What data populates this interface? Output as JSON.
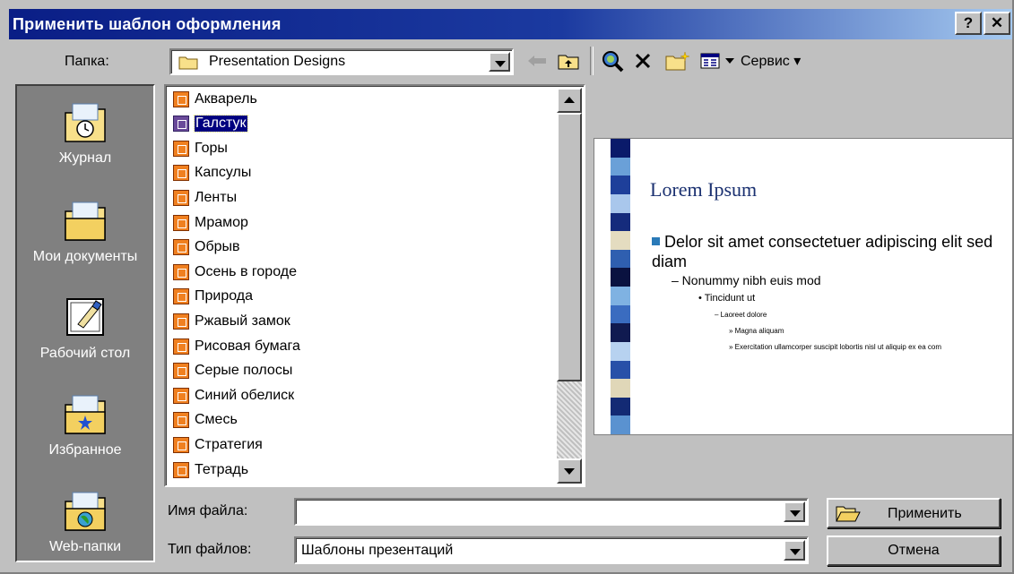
{
  "window": {
    "title": "Применить шаблон оформления",
    "help_label": "?",
    "close_label": "✕"
  },
  "toolbar": {
    "folder_label": "Папка:",
    "folder_value": "Presentation Designs",
    "tools_label": "Сервис ▾",
    "icons": [
      "back-icon",
      "up-folder-icon",
      "search-web-icon",
      "delete-icon",
      "new-folder-icon",
      "views-icon"
    ]
  },
  "places": [
    {
      "label": "Журнал",
      "icon": "history-icon"
    },
    {
      "label": "Мои документы",
      "icon": "my-documents-icon"
    },
    {
      "label": "Рабочий стол",
      "icon": "desktop-icon"
    },
    {
      "label": "Избранное",
      "icon": "favorites-icon"
    },
    {
      "label": "Web-папки",
      "icon": "web-folders-icon"
    }
  ],
  "files": [
    {
      "name": "Акварель",
      "selected": false
    },
    {
      "name": "Галстук",
      "selected": true
    },
    {
      "name": "Горы",
      "selected": false
    },
    {
      "name": "Капсулы",
      "selected": false
    },
    {
      "name": "Ленты",
      "selected": false
    },
    {
      "name": "Мрамор",
      "selected": false
    },
    {
      "name": "Обрыв",
      "selected": false
    },
    {
      "name": "Осень в городе",
      "selected": false
    },
    {
      "name": "Природа",
      "selected": false
    },
    {
      "name": "Ржавый замок",
      "selected": false
    },
    {
      "name": "Рисовая бумага",
      "selected": false
    },
    {
      "name": "Серые полосы",
      "selected": false
    },
    {
      "name": "Синий обелиск",
      "selected": false
    },
    {
      "name": "Смесь",
      "selected": false
    },
    {
      "name": "Стратегия",
      "selected": false
    },
    {
      "name": "Тетрадь",
      "selected": false
    }
  ],
  "preview": {
    "title": "Lorem Ipsum",
    "level1": "Delor sit amet consectetuer adipiscing elit sed diam",
    "level2": "– Nonummy nibh euis mod",
    "level3": "• Tincidunt ut",
    "level4": "– Laoreet dolore",
    "level5": "» Magna aliquam",
    "level6": "» Exercitation ullamcorper suscipit lobortis nisl ut aliquip ex ea com",
    "stripe_colors": [
      "#0a1a6a",
      "#6aa0d8",
      "#1e3f9a",
      "#a9c7ec",
      "#152b7c",
      "#e4dcc0",
      "#2f5fb0",
      "#0a1240",
      "#7fb2e2",
      "#3a6cc0",
      "#101a50",
      "#b7d2f0",
      "#2850a8",
      "#e0d7b8",
      "#132a74",
      "#5a92d0"
    ]
  },
  "form": {
    "filename_label": "Имя файла:",
    "filename_value": "",
    "filetype_label": "Тип файлов:",
    "filetype_value": "Шаблоны презентаций"
  },
  "buttons": {
    "apply": "Применить",
    "cancel": "Отмена"
  }
}
